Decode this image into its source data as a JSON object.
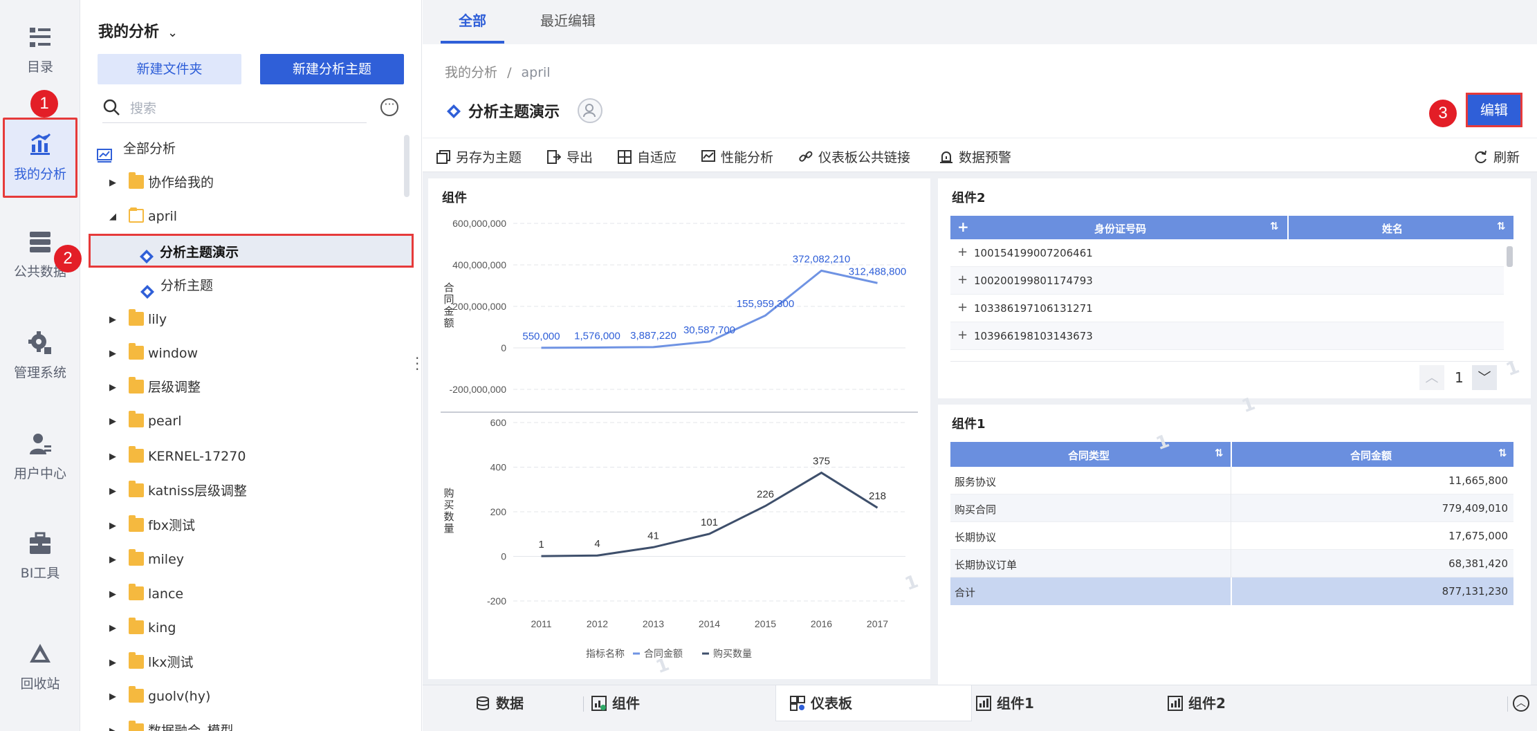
{
  "rail": {
    "items": [
      {
        "label": "目录",
        "icon": "catalog-icon"
      },
      {
        "label": "我的分析",
        "icon": "my-analysis-icon",
        "active": true
      },
      {
        "label": "公共数据",
        "icon": "public-data-icon"
      },
      {
        "label": "管理系统",
        "icon": "settings-gear-icon"
      },
      {
        "label": "用户中心",
        "icon": "user-center-icon"
      },
      {
        "label": "BI工具",
        "icon": "toolbox-icon"
      },
      {
        "label": "回收站",
        "icon": "recycle-bin-icon"
      }
    ]
  },
  "badges": {
    "one": "1",
    "two": "2",
    "three": "3"
  },
  "tree": {
    "title": "我的分析",
    "new_folder": "新建文件夹",
    "new_subject": "新建分析主题",
    "search_placeholder": "搜索",
    "root": "全部分析",
    "items": [
      {
        "label": "协作给我的",
        "type": "shared-folder"
      },
      {
        "label": "april",
        "type": "folder-open"
      },
      {
        "label": "分析主题演示",
        "type": "subject",
        "selected": true
      },
      {
        "label": "分析主题",
        "type": "subject"
      },
      {
        "label": "lily",
        "type": "folder"
      },
      {
        "label": "window",
        "type": "folder"
      },
      {
        "label": "层级调整",
        "type": "folder"
      },
      {
        "label": "pearl",
        "type": "folder"
      },
      {
        "label": "KERNEL-17270",
        "type": "folder"
      },
      {
        "label": "katniss层级调整",
        "type": "folder"
      },
      {
        "label": "fbx测试",
        "type": "folder"
      },
      {
        "label": "miley",
        "type": "folder"
      },
      {
        "label": "lance",
        "type": "folder"
      },
      {
        "label": "king",
        "type": "folder"
      },
      {
        "label": "lkx测试",
        "type": "folder"
      },
      {
        "label": "guolv(hy)",
        "type": "folder"
      },
      {
        "label": "数据融合_模型",
        "type": "folder"
      }
    ]
  },
  "tabs": {
    "all": "全部",
    "recent": "最近编辑"
  },
  "header": {
    "crumb_root": "我的分析",
    "crumb_sep": "/",
    "crumb_current": "april",
    "title": "分析主题演示",
    "edit": "编辑"
  },
  "toolbar": {
    "save_as": "另存为主题",
    "export": "导出",
    "adaptive": "自适应",
    "performance": "性能分析",
    "public_link": "仪表板公共链接",
    "alert": "数据预警",
    "refresh": "刷新"
  },
  "colors": {
    "accent": "#2f5fd8",
    "line1": "#6f93e3",
    "line2": "#3e4f6b",
    "highlight": "#e63a3a"
  },
  "chart_panel": {
    "title": "组件"
  },
  "chart_data": [
    {
      "type": "line",
      "x": [
        "2011",
        "2012",
        "2013",
        "2014",
        "2015",
        "2016",
        "2017"
      ],
      "series": [
        {
          "name": "合同金额",
          "values": [
            550000,
            1576000,
            3887220,
            30587700,
            155959300,
            372082210,
            312488800
          ]
        }
      ],
      "labels": [
        "550,000",
        "1,576,000",
        "3,887,220",
        "30,587,700",
        "155,959,300",
        "372,082,210",
        "312,488,800"
      ],
      "ylabel": "合同金额",
      "yticks": [
        "600,000,000",
        "400,000,000",
        "200,000,000",
        "0",
        "-200,000,000"
      ],
      "ylim": [
        -200000000,
        600000000
      ]
    },
    {
      "type": "line",
      "x": [
        "2011",
        "2012",
        "2013",
        "2014",
        "2015",
        "2016",
        "2017"
      ],
      "series": [
        {
          "name": "购买数量",
          "values": [
            1,
            4,
            41,
            101,
            226,
            375,
            218
          ]
        }
      ],
      "labels": [
        "1",
        "4",
        "41",
        "101",
        "226",
        "375",
        "218"
      ],
      "ylabel": "购买数量",
      "yticks": [
        "600",
        "400",
        "200",
        "0",
        "-200"
      ],
      "ylim": [
        -200,
        600
      ],
      "legend_title": "指标名称",
      "legend": [
        "合同金额",
        "购买数量"
      ]
    }
  ],
  "table2": {
    "title": "组件2",
    "plus": "+",
    "columns": [
      "身份证号码",
      "姓名"
    ],
    "rows": [
      "100154199007206461",
      "100200199801174793",
      "103386197106131271",
      "103966198103143673"
    ],
    "page": "1"
  },
  "table1": {
    "title": "组件1",
    "columns": [
      "合同类型",
      "合同金额"
    ],
    "rows": [
      [
        "服务协议",
        "11,665,800"
      ],
      [
        "购买合同",
        "779,409,010"
      ],
      [
        "长期协议",
        "17,675,000"
      ],
      [
        "长期协议订单",
        "68,381,420"
      ]
    ],
    "total": [
      "合计",
      "877,131,230"
    ]
  },
  "bottom": {
    "data": "数据",
    "component": "组件",
    "dashboard": "仪表板",
    "component1": "组件1",
    "component2": "组件2"
  }
}
